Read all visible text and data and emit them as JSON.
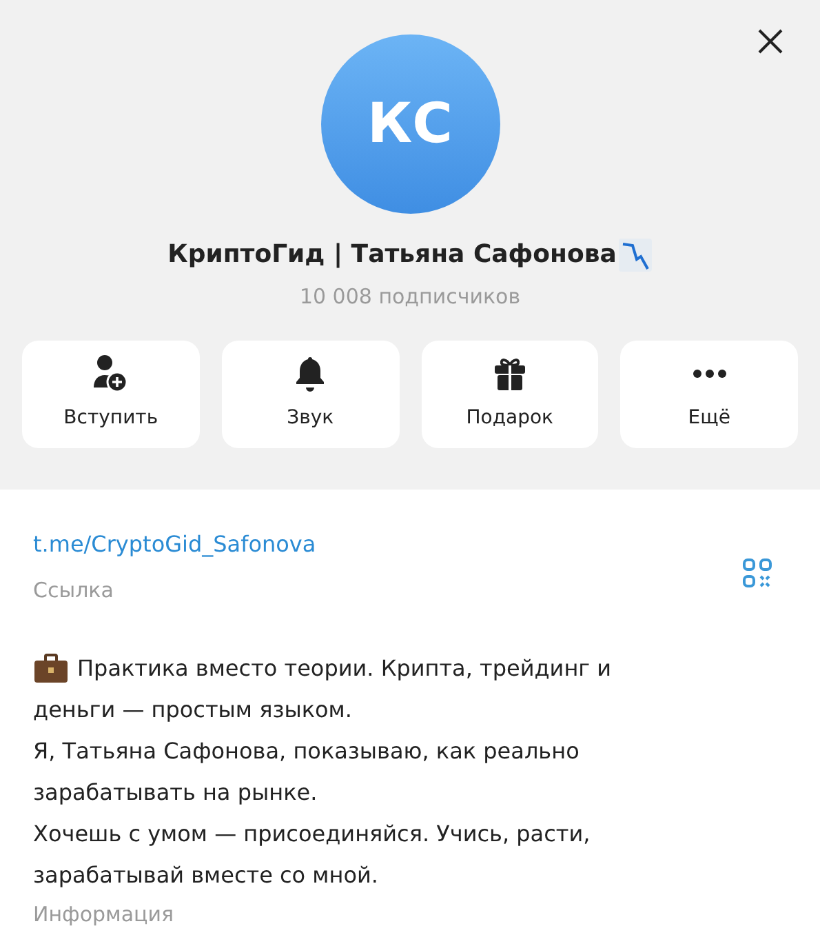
{
  "avatar": {
    "initials": "КС"
  },
  "channel": {
    "name": "КриптоГид | Татьяна Сафонова",
    "subscribers": "10 008 подписчиков"
  },
  "actions": [
    {
      "kind": "join",
      "label": "Вступить"
    },
    {
      "kind": "sound",
      "label": "Звук"
    },
    {
      "kind": "gift",
      "label": "Подарок"
    },
    {
      "kind": "more",
      "label": "Ещё"
    }
  ],
  "link": {
    "value": "t.me/CryptoGid_Safonova",
    "label": "Ссылка"
  },
  "info": {
    "lines": [
      "Практика вместо теории. Крипта, трейдинг и",
      "деньги — простым языком.",
      "Я, Татьяна Сафонова, показываю, как реально",
      "зарабатывать на рынке.",
      "Хочешь с умом — присоединяйся. Учись, расти,",
      "зарабатывай вместе со мной."
    ],
    "label": "Информация"
  }
}
